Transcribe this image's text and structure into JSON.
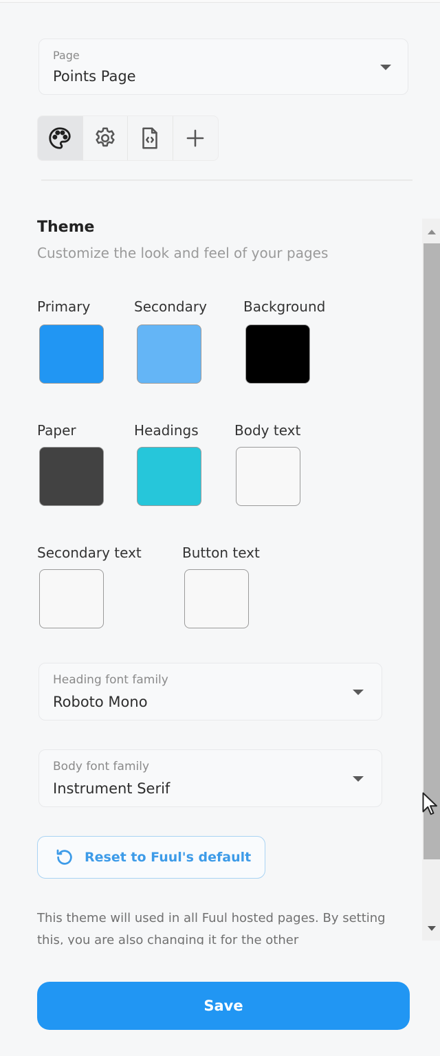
{
  "page_select": {
    "label": "Page",
    "value": "Points Page"
  },
  "tabs": [
    {
      "name": "theme",
      "icon": "palette-icon",
      "active": true
    },
    {
      "name": "settings",
      "icon": "gear-icon",
      "active": false
    },
    {
      "name": "code",
      "icon": "code-file-icon",
      "active": false
    },
    {
      "name": "add",
      "icon": "plus-icon",
      "active": false
    }
  ],
  "theme": {
    "title": "Theme",
    "subtitle": "Customize the look and feel of your pages",
    "colors": [
      {
        "label": "Primary",
        "color": "#2196f3"
      },
      {
        "label": "Secondary",
        "color": "#64b5f6"
      },
      {
        "label": "Background",
        "color": "#000000"
      },
      {
        "label": "Paper",
        "color": "#424242"
      },
      {
        "label": "Headings",
        "color": "#26c6da"
      },
      {
        "label": "Body text",
        "color": "#f8f8f8"
      },
      {
        "label": "Secondary text",
        "color": "#f8f8f8"
      },
      {
        "label": "Button text",
        "color": "#f8f8f8"
      }
    ],
    "heading_font": {
      "label": "Heading font family",
      "value": "Roboto Mono"
    },
    "body_font": {
      "label": "Body font family",
      "value": "Instrument Serif"
    },
    "reset_label": "Reset to Fuul's default",
    "info_text": "This theme will used in all Fuul hosted pages. By setting this, you are also changing it for the other"
  },
  "save_label": "Save",
  "accent": "#2196f3"
}
